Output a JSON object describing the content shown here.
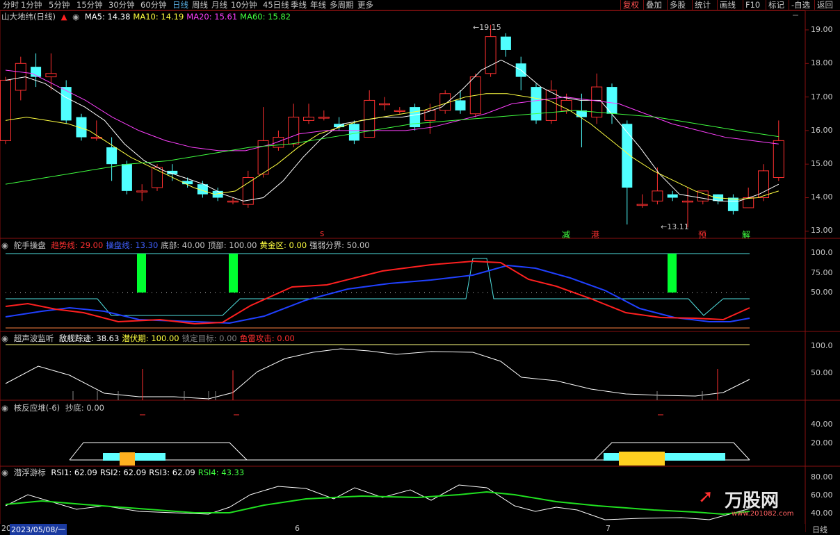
{
  "topbar": {
    "periods": [
      "分时",
      "1分钟",
      "5分钟",
      "15分钟",
      "30分钟",
      "60分钟",
      "日线",
      "周线",
      "月线",
      "10分钟",
      "45日线",
      "季线",
      "年线",
      "多周期",
      "更多"
    ],
    "active_period": "日线",
    "buttons": [
      "复权",
      "叠加",
      "多股",
      "统计",
      "画线",
      "F10",
      "标记",
      "-自选",
      "返回"
    ],
    "active_button": "复权"
  },
  "main": {
    "title": "山大地纬(日线)",
    "ma": [
      {
        "label": "MA5: 14.38",
        "color": "#ffffff"
      },
      {
        "label": "MA10: 14.19",
        "color": "#ffff40"
      },
      {
        "label": "MA20: 15.61",
        "color": "#ff40ff"
      },
      {
        "label": "MA60: 15.82",
        "color": "#40ff40"
      }
    ],
    "y_ticks": [
      "19.00",
      "18.00",
      "17.00",
      "16.00",
      "15.00",
      "14.00",
      "13.00"
    ],
    "high_label": "19.15",
    "low_label": "13.11",
    "signals": [
      {
        "text": "s",
        "color": "#ff3030"
      },
      {
        "text": "减",
        "color": "#40ff40"
      },
      {
        "text": "港",
        "color": "#ff3030"
      },
      {
        "text": "预",
        "color": "#ff3030"
      },
      {
        "text": "解",
        "color": "#40ff40"
      }
    ]
  },
  "panel2": {
    "title": "舵手操盘",
    "items": [
      {
        "label": "趋势线: 29.00",
        "color": "#ff3030"
      },
      {
        "label": "操盘线: 13.30",
        "color": "#4060ff"
      },
      {
        "label": "底部: 40.00",
        "color": "#c8c8c8"
      },
      {
        "label": "顶部: 100.00",
        "color": "#c8c8c8"
      },
      {
        "label": "黄金区: 0.00",
        "color": "#ffff40"
      },
      {
        "label": "强弱分界: 50.00",
        "color": "#c8c8c8"
      }
    ],
    "y_ticks": [
      "100.0",
      "75.00",
      "50.00"
    ]
  },
  "panel3": {
    "title": "超声波监听",
    "items": [
      {
        "label": "敌舰踪迹: 38.63",
        "color": "#ffffff"
      },
      {
        "label": "潜伏期: 100.00",
        "color": "#ffff40"
      },
      {
        "label": "锁定目标: 0.00",
        "color": "#808080"
      },
      {
        "label": "鱼雷攻击: 0.00",
        "color": "#ff3030"
      }
    ],
    "y_ticks": [
      "100.0",
      "50.00"
    ]
  },
  "panel4": {
    "title": "核反应堆(-6)",
    "items": [
      {
        "label": "抄底: 0.00",
        "color": "#c8c8c8"
      }
    ],
    "y_ticks": [
      "40.00",
      "20.00"
    ]
  },
  "panel5": {
    "title": "潜浮游标",
    "items": [
      {
        "label": "RSI1: 62.09",
        "color": "#ffffff"
      },
      {
        "label": "RSI2: 62.09",
        "color": "#ffffff"
      },
      {
        "label": "RSI3: 62.09",
        "color": "#ffffff"
      },
      {
        "label": "RSI4: 43.33",
        "color": "#40ff40"
      }
    ],
    "y_ticks": [
      "80.00",
      "60.00",
      "40.00"
    ]
  },
  "bottom": {
    "cursor_date_prefix": "20",
    "cursor_date": "2023/05/08/一",
    "month_labels": [
      "6",
      "7"
    ],
    "right_label": "日线"
  },
  "watermark": {
    "brand": "万股网",
    "url": "www.201082.com"
  }
}
